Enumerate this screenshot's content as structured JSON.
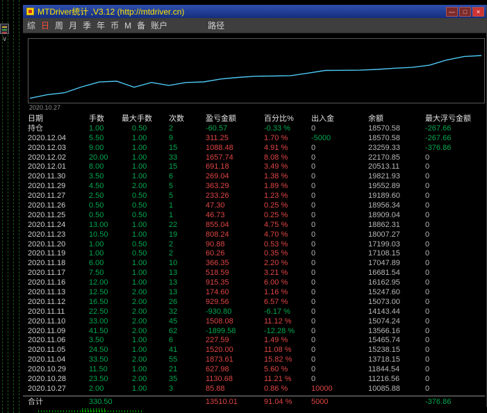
{
  "window": {
    "title": "MTDriver统计 ,V3.12 (http://mtdriver.cn)",
    "controls": {
      "minimize": "—",
      "maximize": "□",
      "close": "×"
    }
  },
  "menu": {
    "items": [
      "综",
      "日",
      "周",
      "月",
      "季",
      "年",
      "币",
      "M",
      "备",
      "账户"
    ],
    "active_item": "日",
    "path_item": "路径"
  },
  "chart_data": {
    "type": "line",
    "title": "",
    "xlabel": "",
    "ylabel": "",
    "x": [
      "2020.10.27",
      "2020.10.28",
      "2020.10.29",
      "2020.11.04",
      "2020.11.05",
      "2020.11.06",
      "2020.11.09",
      "2020.11.10",
      "2020.11.11",
      "2020.11.12",
      "2020.11.13",
      "2020.11.16",
      "2020.11.17",
      "2020.11.18",
      "2020.11.19",
      "2020.11.20",
      "2020.11.23",
      "2020.11.24",
      "2020.11.25",
      "2020.11.26",
      "2020.11.27",
      "2020.11.29",
      "2020.11.30",
      "2020.12.01",
      "2020.12.02",
      "2020.12.03",
      "2020.12.04"
    ],
    "values": [
      10085.88,
      11216.56,
      11844.54,
      13718.15,
      15238.15,
      15465.74,
      13566.16,
      15074.24,
      14143.44,
      15073.0,
      15247.6,
      16162.95,
      16681.54,
      17047.89,
      17108.15,
      17199.03,
      18007.27,
      18862.31,
      18909.04,
      18956.34,
      19189.6,
      19552.89,
      19821.93,
      20513.11,
      22170.85,
      23259.33,
      23570.58
    ],
    "y_min": 10000,
    "y_max": 24000,
    "axis_date_label": "2020.10.27",
    "line_color": "#4fc8f5",
    "grid": false,
    "legend": false
  },
  "table": {
    "headers": [
      "日期",
      "手数",
      "最大手数",
      "次数",
      "盈亏金额",
      "百分比%",
      "出入金",
      "余额",
      "最大浮亏金额"
    ],
    "rows": [
      [
        "持仓",
        "1.00",
        "0.50",
        "2",
        "-60.57",
        "-0.33 %",
        "0",
        "18570.58",
        "-267.66"
      ],
      [
        "2020.12.04",
        "5.50",
        "1.00",
        "9",
        "311.25",
        "1.70 %",
        "-5000",
        "18570.58",
        "-267.66"
      ],
      [
        "2020.12.03",
        "9.00",
        "1.00",
        "15",
        "1088.48",
        "4.91 %",
        "0",
        "23259.33",
        "-376.86"
      ],
      [
        "2020.12.02",
        "20.00",
        "1.00",
        "33",
        "1657.74",
        "8.08 %",
        "0",
        "22170.85",
        "0"
      ],
      [
        "2020.12.01",
        "8.00",
        "1.00",
        "15",
        "691.18",
        "3.49 %",
        "0",
        "20513.11",
        "0"
      ],
      [
        "2020.11.30",
        "3.50",
        "1.00",
        "6",
        "269.04",
        "1.38 %",
        "0",
        "19821.93",
        "0"
      ],
      [
        "2020.11.29",
        "4.50",
        "2.00",
        "5",
        "363.29",
        "1.89 %",
        "0",
        "19552.89",
        "0"
      ],
      [
        "2020.11.27",
        "2.50",
        "0.50",
        "5",
        "233.26",
        "1.23 %",
        "0",
        "19189.60",
        "0"
      ],
      [
        "2020.11.26",
        "0.50",
        "0.50",
        "1",
        "47.30",
        "0.25 %",
        "0",
        "18956.34",
        "0"
      ],
      [
        "2020.11.25",
        "0.50",
        "0.50",
        "1",
        "46.73",
        "0.25 %",
        "0",
        "18909.04",
        "0"
      ],
      [
        "2020.11.24",
        "13.00",
        "1.00",
        "22",
        "855.04",
        "4.75 %",
        "0",
        "18862.31",
        "0"
      ],
      [
        "2020.11.23",
        "10.50",
        "1.00",
        "19",
        "808.24",
        "4.70 %",
        "0",
        "18007.27",
        "0"
      ],
      [
        "2020.11.20",
        "1.00",
        "0.50",
        "2",
        "90.88",
        "0.53 %",
        "0",
        "17199.03",
        "0"
      ],
      [
        "2020.11.19",
        "1.00",
        "0.50",
        "2",
        "60.26",
        "0.35 %",
        "0",
        "17108.15",
        "0"
      ],
      [
        "2020.11.18",
        "6.00",
        "1.00",
        "10",
        "366.35",
        "2.20 %",
        "0",
        "17047.89",
        "0"
      ],
      [
        "2020.11.17",
        "7.50",
        "1.00",
        "13",
        "518.59",
        "3.21 %",
        "0",
        "16681.54",
        "0"
      ],
      [
        "2020.11.16",
        "12.00",
        "1.00",
        "13",
        "915.35",
        "6.00 %",
        "0",
        "16162.95",
        "0"
      ],
      [
        "2020.11.13",
        "12.50",
        "2.00",
        "13",
        "174.60",
        "1.16 %",
        "0",
        "15247.60",
        "0"
      ],
      [
        "2020.11.12",
        "16.50",
        "2.00",
        "26",
        "929.56",
        "6.57 %",
        "0",
        "15073.00",
        "0"
      ],
      [
        "2020.11.11",
        "22.50",
        "2.00",
        "32",
        "-930.80",
        "-6.17 %",
        "0",
        "14143.44",
        "0"
      ],
      [
        "2020.11.10",
        "33.00",
        "2.00",
        "45",
        "1508.08",
        "11.12 %",
        "0",
        "15074.24",
        "0"
      ],
      [
        "2020.11.09",
        "41.50",
        "2.00",
        "62",
        "-1899.58",
        "-12.28 %",
        "0",
        "13566.16",
        "0"
      ],
      [
        "2020.11.06",
        "3.50",
        "1.00",
        "6",
        "227.59",
        "1.49 %",
        "0",
        "15465.74",
        "0"
      ],
      [
        "2020.11.05",
        "24.50",
        "1.00",
        "41",
        "1520.00",
        "11.08 %",
        "0",
        "15238.15",
        "0"
      ],
      [
        "2020.11.04",
        "33.50",
        "2.00",
        "55",
        "1873.61",
        "15.82 %",
        "0",
        "13718.15",
        "0"
      ],
      [
        "2020.10.29",
        "11.50",
        "1.00",
        "21",
        "627.98",
        "5.60 %",
        "0",
        "11844.54",
        "0"
      ],
      [
        "2020.10.28",
        "23.50",
        "2.00",
        "35",
        "1130.68",
        "11.21 %",
        "0",
        "11216.56",
        "0"
      ],
      [
        "2020.10.27",
        "2.00",
        "1.00",
        "3",
        "85.88",
        "0.86 %",
        "10000",
        "10085.88",
        "0"
      ]
    ],
    "total_row": [
      "合计",
      "330.50",
      "",
      "",
      "13510.01",
      "91.04 %",
      "5000",
      "",
      "-376.86"
    ]
  },
  "colors": {
    "profit_red": "#e04545",
    "loss_green": "#00a850",
    "chart_line": "#4fc8f5",
    "title_text": "#ffe600"
  }
}
